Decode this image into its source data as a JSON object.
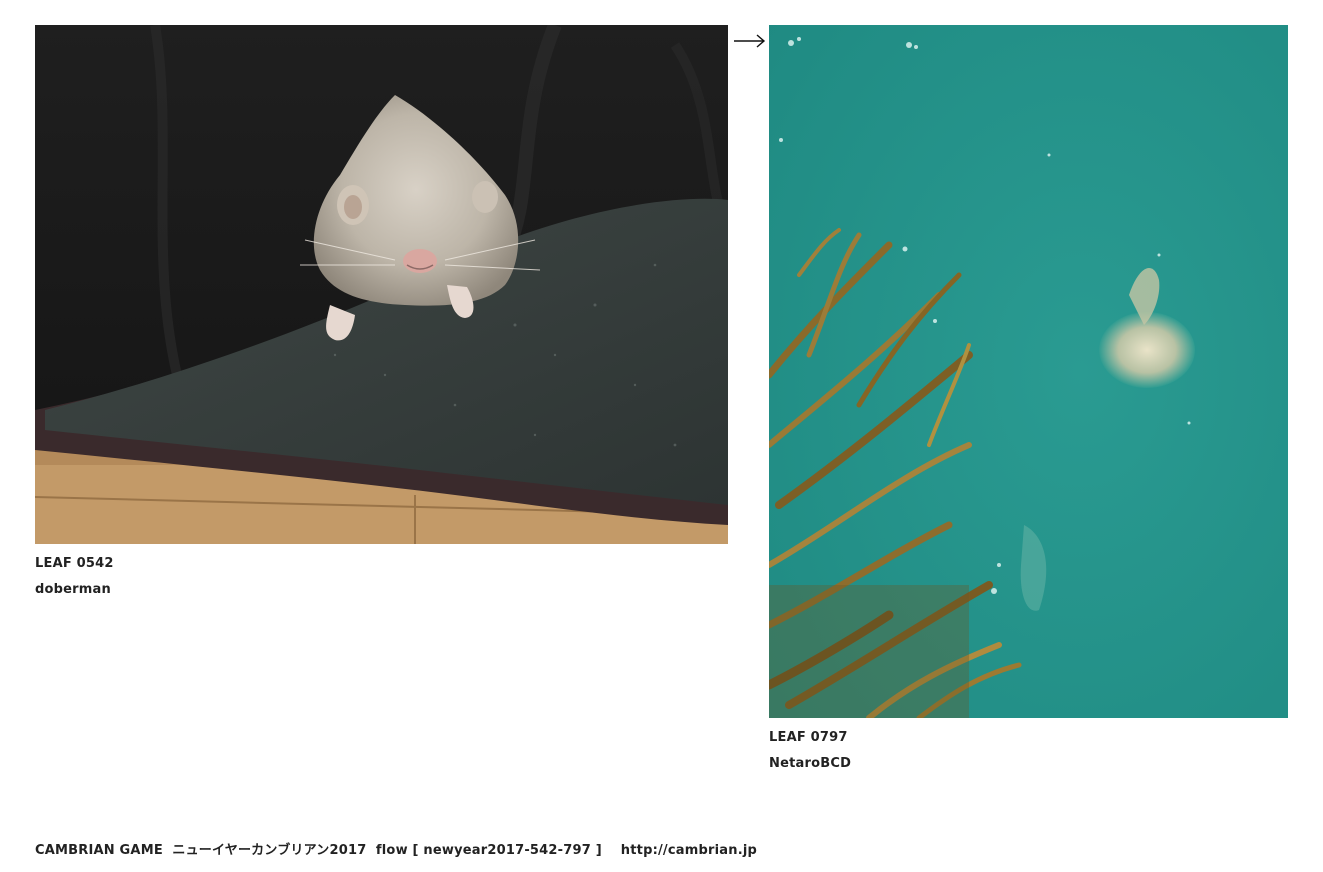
{
  "leaves": [
    {
      "id_label": "LEAF 0542",
      "author": "doberman"
    },
    {
      "id_label": "LEAF 0797",
      "author": "NetaroBCD"
    }
  ],
  "footer": {
    "game": "CAMBRIAN GAME",
    "event": "ニューイヤーカンブリアン2017",
    "flow_prefix": "flow [",
    "flow_id": "newyear2017-542-797",
    "flow_suffix": "]",
    "site_url": "http://cambrian.jp"
  },
  "icons": {
    "flow_arrow": "right-arrow-icon"
  }
}
